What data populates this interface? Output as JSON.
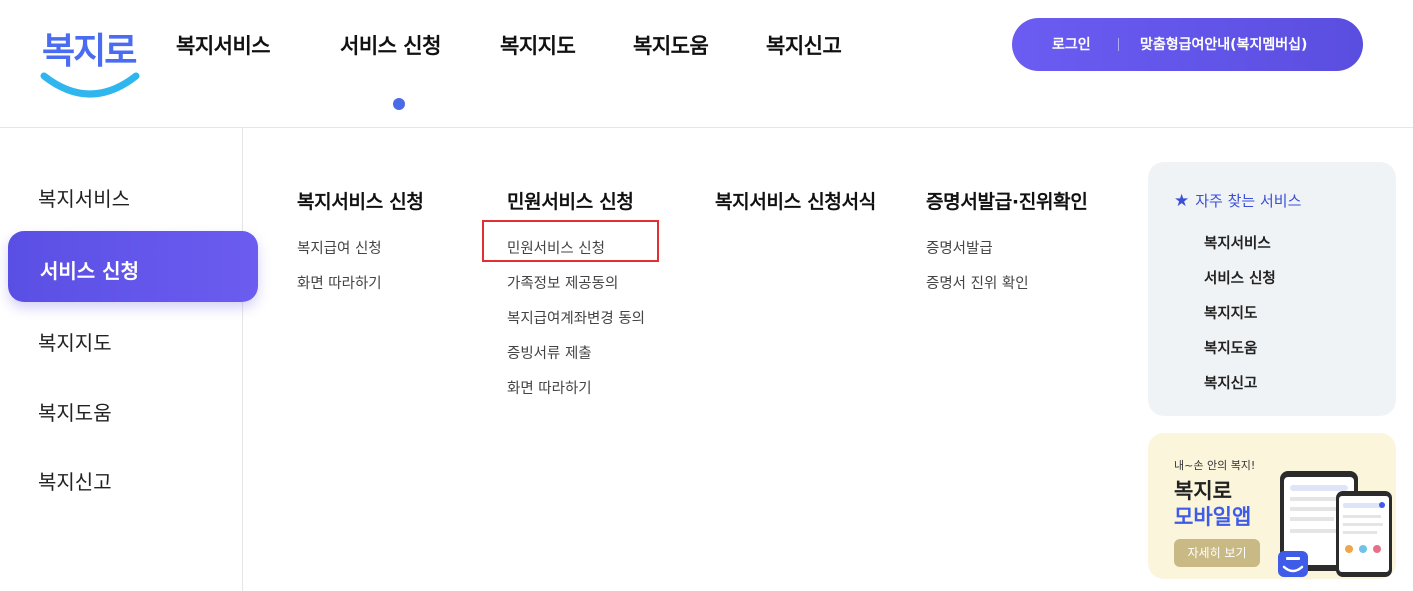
{
  "header": {
    "logo_text": "복지로",
    "nav": [
      "복지서비스",
      "서비스 신청",
      "복지지도",
      "복지도움",
      "복지신고"
    ],
    "active_nav": "서비스 신청",
    "login_label": "로그인",
    "membership_label": "맞춤형급여안내(복지멤버십)"
  },
  "sidebar": {
    "items": [
      "복지서비스",
      "서비스 신청",
      "복지지도",
      "복지도움",
      "복지신고"
    ],
    "active": "서비스 신청"
  },
  "menu": {
    "columns": [
      {
        "title": "복지서비스 신청",
        "links": [
          "복지급여 신청",
          "화면 따라하기"
        ]
      },
      {
        "title": "민원서비스 신청",
        "links": [
          "민원서비스 신청",
          "가족정보 제공동의",
          "복지급여계좌변경 동의",
          "증빙서류 제출",
          "화면 따라하기"
        ]
      },
      {
        "title": "복지서비스 신청서식",
        "links": []
      },
      {
        "title": "증명서발급·진위확인",
        "links": [
          "증명서발급",
          "증명서 진위 확인"
        ]
      }
    ]
  },
  "favorites": {
    "title": "자주 찾는 서비스",
    "icon": "star-icon",
    "links": [
      "복지서비스",
      "서비스 신청",
      "복지지도",
      "복지도움",
      "복지신고"
    ]
  },
  "app_banner": {
    "small_text": "내~손 안의 복지!",
    "line1": "복지로",
    "line2": "모바일앱",
    "button_label": "자세히 보기"
  },
  "colors": {
    "accent": "#5a4fe4",
    "brand_blue": "#3f5ce8",
    "highlight": "#e03030"
  }
}
